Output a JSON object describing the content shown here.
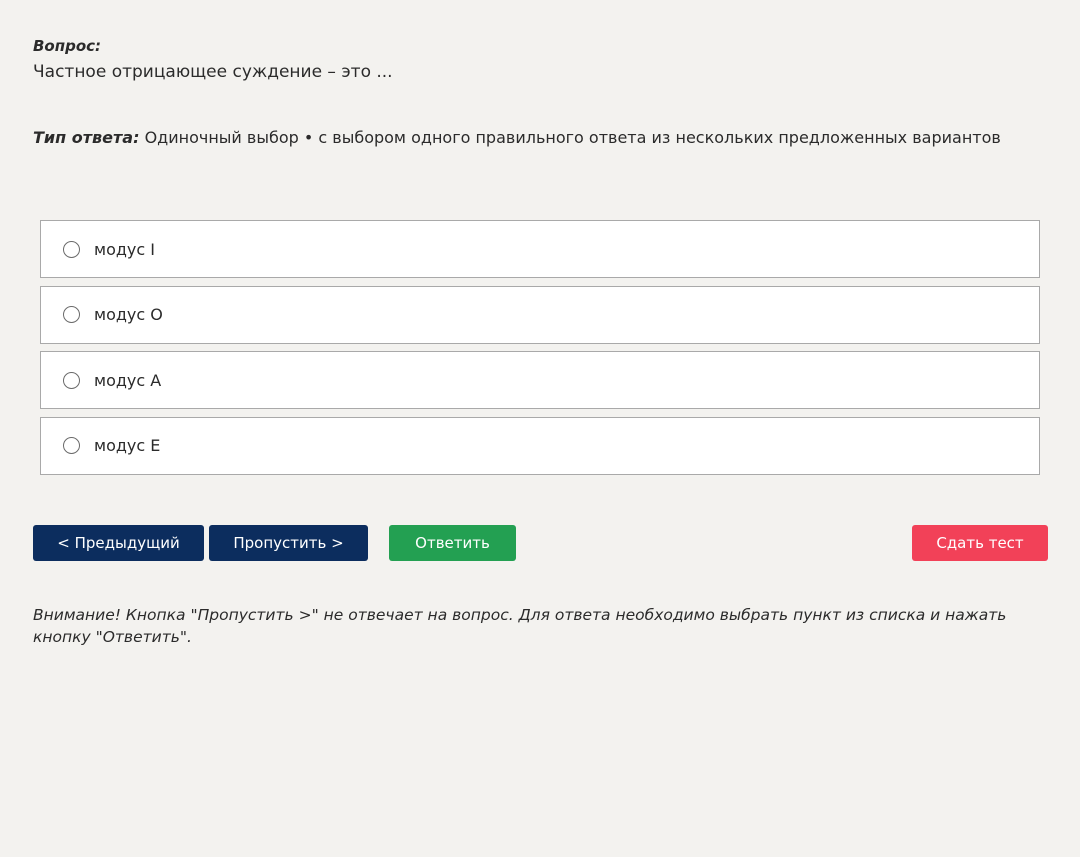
{
  "question": {
    "label": "Вопрос:",
    "text": "Частное отрицающее суждение – это ..."
  },
  "answer_type": {
    "label": "Тип ответа:",
    "value": "Одиночный выбор • с выбором одного правильного ответа из нескольких предложенных вариантов"
  },
  "options": [
    {
      "label": "модус I",
      "selected": false
    },
    {
      "label": "модус O",
      "selected": false
    },
    {
      "label": "модус A",
      "selected": false
    },
    {
      "label": "модус E",
      "selected": false
    }
  ],
  "buttons": {
    "prev": "< Предыдущий",
    "skip": "Пропустить >",
    "answer": "Ответить",
    "submit": "Сдать тест"
  },
  "notice": "Внимание! Кнопка \"Пропустить >\" не отвечает на вопрос. Для ответа необходимо выбрать пункт из списка и нажать кнопку \"Ответить\".",
  "colors": {
    "background": "#f3f2ef",
    "nav_button": "#0c2d5e",
    "answer_button": "#23a052",
    "submit_button": "#f24158"
  }
}
